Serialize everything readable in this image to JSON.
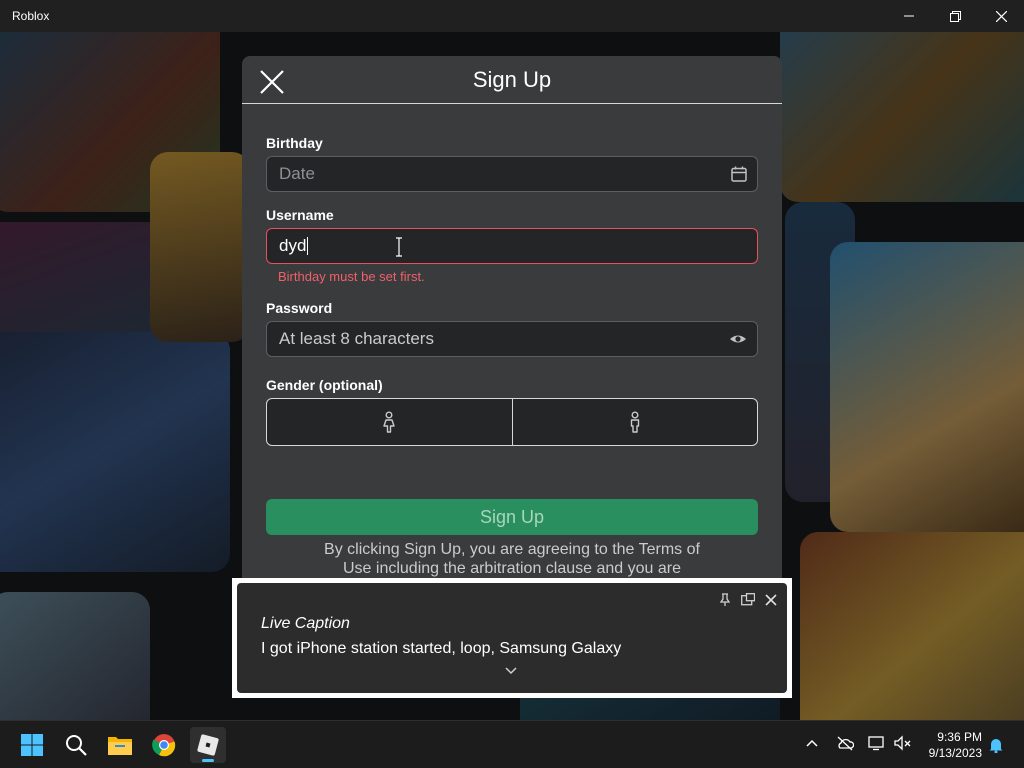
{
  "window": {
    "title": "Roblox"
  },
  "dialog": {
    "title": "Sign Up",
    "birthday": {
      "label": "Birthday",
      "placeholder": "Date"
    },
    "username": {
      "label": "Username",
      "value": "dyd",
      "error": "Birthday must be set first."
    },
    "password": {
      "label": "Password",
      "placeholder": "At least 8 characters"
    },
    "gender": {
      "label": "Gender (optional)"
    },
    "signup_button": "Sign Up",
    "terms_line1": "By clicking Sign Up, you are agreeing to the Terms of",
    "terms_line2": "Use including the arbitration clause and you are"
  },
  "live_caption": {
    "title": "Live Caption",
    "text": "I got iPhone station started, loop, Samsung Galaxy"
  },
  "taskbar": {
    "time": "9:36 PM",
    "date": "9/13/2023",
    "apps": [
      "start-icon",
      "search-icon",
      "file-explorer-icon",
      "chrome-icon",
      "roblox-icon"
    ]
  },
  "colors": {
    "dialog_bg": "#393b3d",
    "input_bg": "#232527",
    "error": "#e8505b",
    "signup_green": "#2a8f5e",
    "accent": "#4cc2ff"
  }
}
